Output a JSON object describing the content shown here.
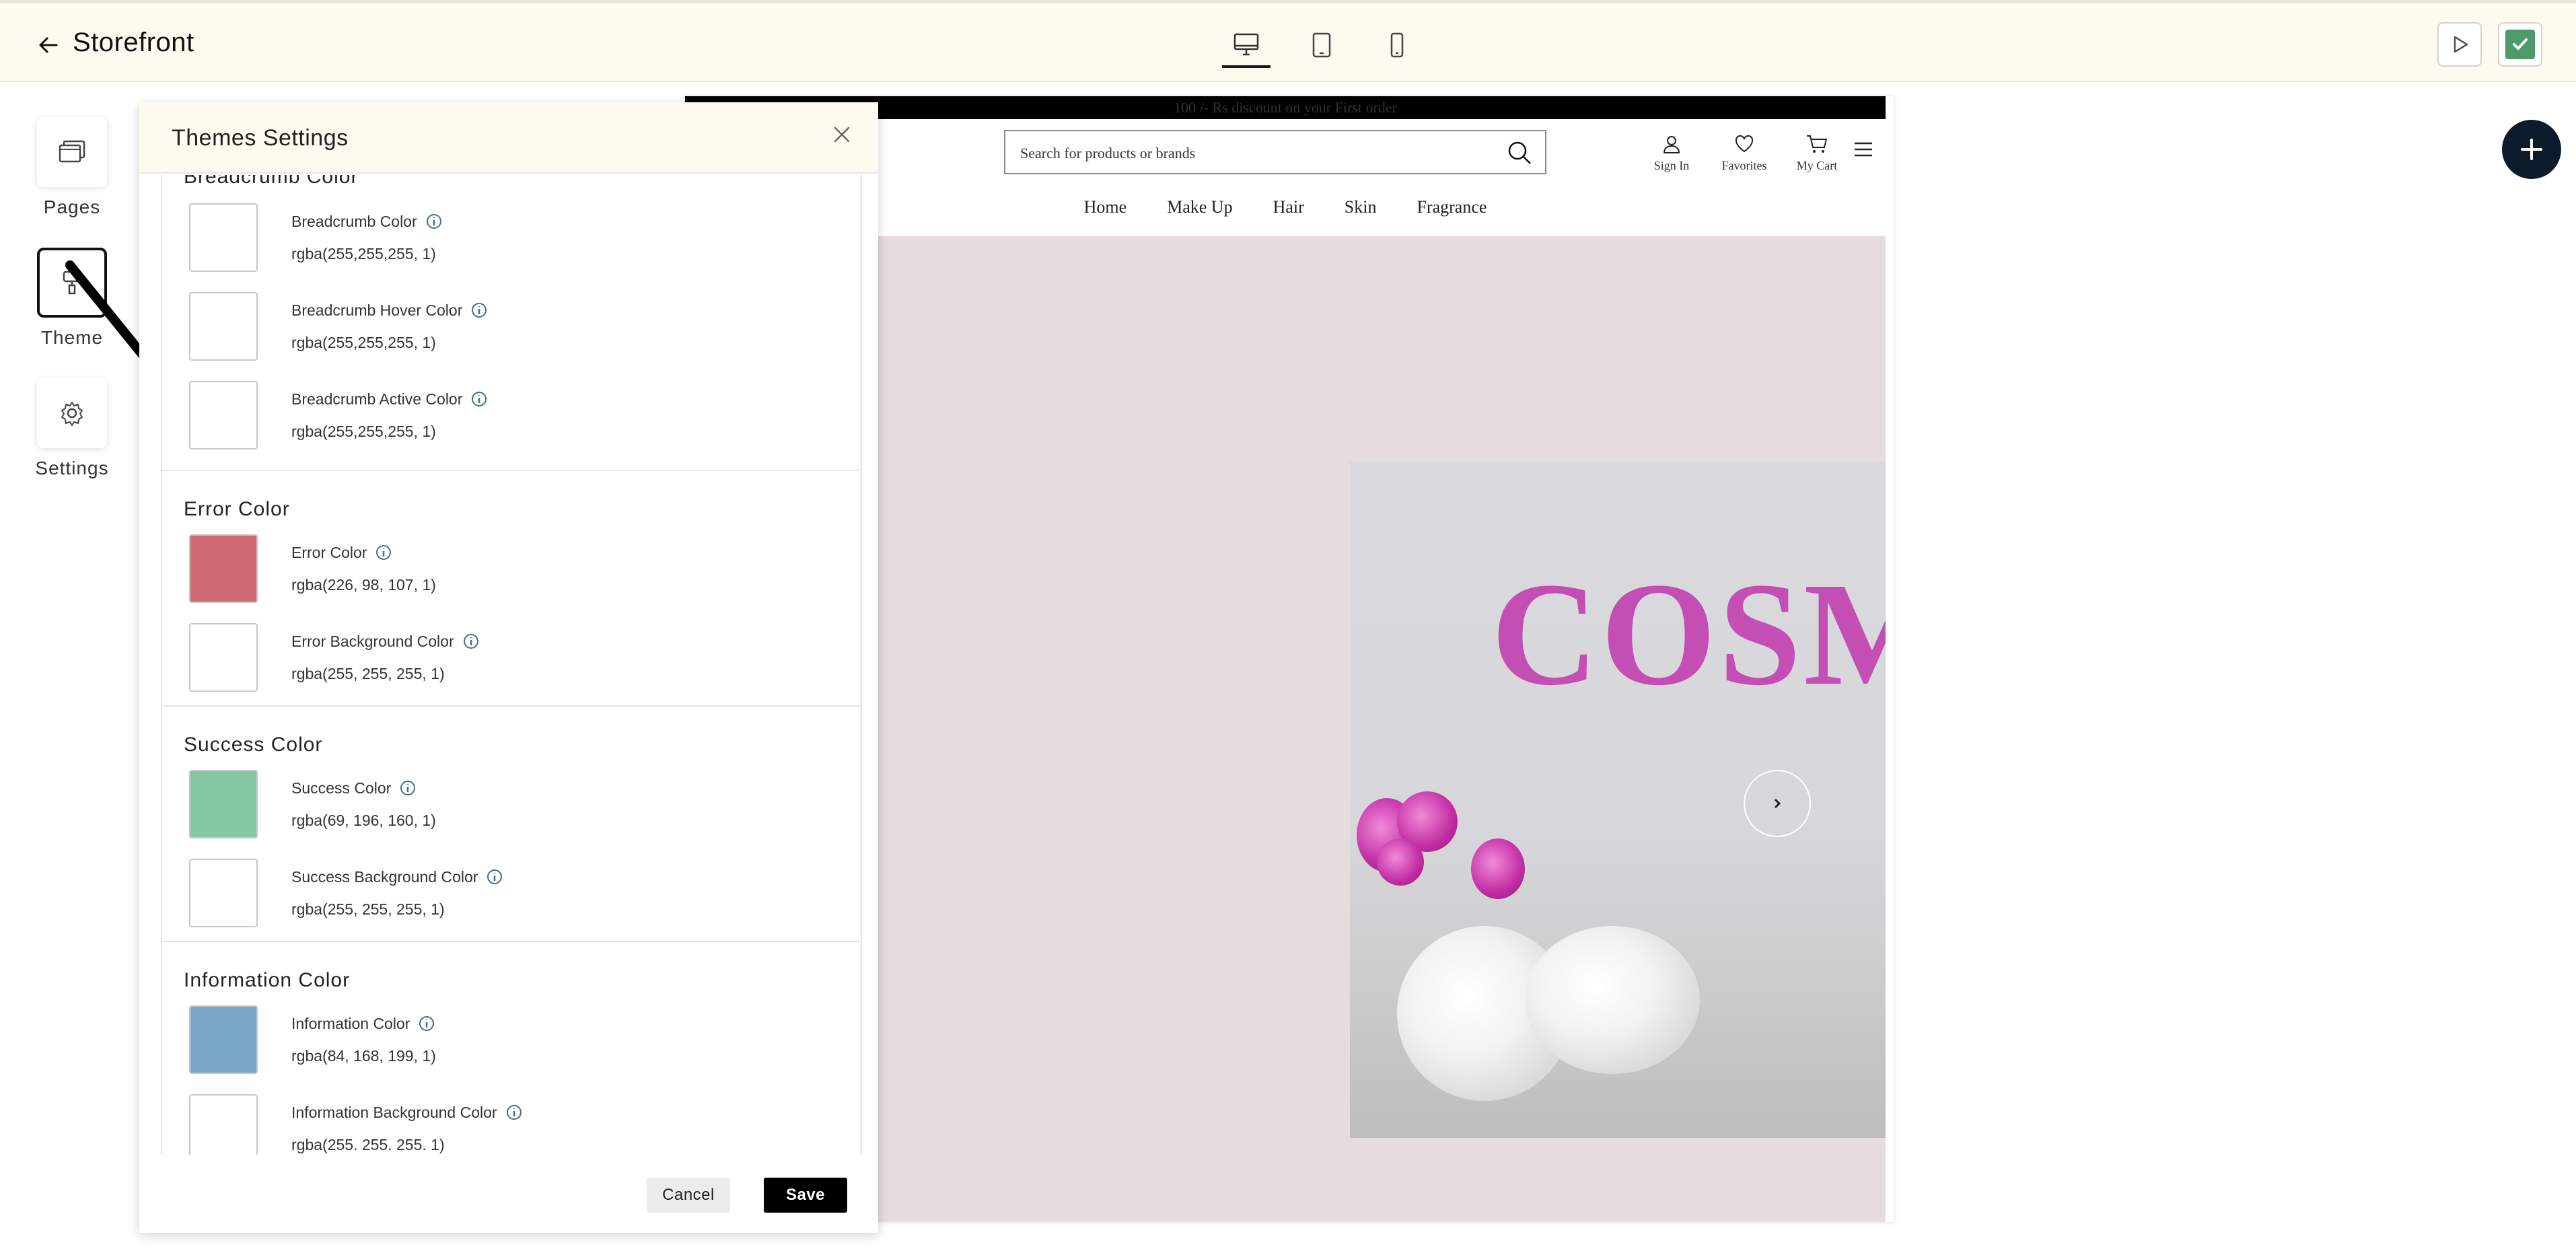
{
  "header": {
    "title": "Storefront",
    "devices": [
      "desktop",
      "tablet",
      "mobile"
    ],
    "active_device": "desktop",
    "publish_color": "#4f9a6b"
  },
  "rail": {
    "items": [
      {
        "label": "Pages",
        "icon": "pages-icon"
      },
      {
        "label": "Theme",
        "icon": "paint-brush-icon",
        "active": true
      },
      {
        "label": "Settings",
        "icon": "gear-icon"
      }
    ]
  },
  "panel": {
    "title": "Themes Settings",
    "sections": [
      {
        "title": "Breadcrumb Color",
        "rows": [
          {
            "label": "Breadcrumb Color",
            "value": "rgba(255,255,255, 1)",
            "swatch": "#ffffff"
          },
          {
            "label": "Breadcrumb Hover Color",
            "value": "rgba(255,255,255, 1)",
            "swatch": "#ffffff"
          },
          {
            "label": "Breadcrumb Active Color",
            "value": "rgba(255,255,255, 1)",
            "swatch": "#ffffff"
          }
        ]
      },
      {
        "title": "Error Color",
        "rows": [
          {
            "label": "Error Color",
            "value": "rgba(226, 98, 107, 1)",
            "swatch": "#cf6a72"
          },
          {
            "label": "Error Background Color",
            "value": "rgba(255, 255, 255, 1)",
            "swatch": "#ffffff"
          }
        ]
      },
      {
        "title": "Success Color",
        "rows": [
          {
            "label": "Success Color",
            "value": "rgba(69, 196, 160, 1)",
            "swatch": "#84c7a3"
          },
          {
            "label": "Success Background Color",
            "value": "rgba(255, 255, 255, 1)",
            "swatch": "#ffffff"
          }
        ]
      },
      {
        "title": "Information Color",
        "rows": [
          {
            "label": "Information Color",
            "value": "rgba(84, 168, 199, 1)",
            "swatch": "#79a8c8"
          },
          {
            "label": "Information Background Color",
            "value": "rgba(255. 255. 255. 1)",
            "swatch": "#ffffff"
          }
        ]
      }
    ],
    "cancel_label": "Cancel",
    "save_label": "Save"
  },
  "preview": {
    "promo": "100 /- Rs discount on your First order",
    "search_placeholder": "Search for products or brands",
    "actions": {
      "sign_in": "Sign In",
      "favorites": "Favorites",
      "cart": "My Cart"
    },
    "nav": [
      "Home",
      "Make Up",
      "Hair",
      "Skin",
      "Fragrance"
    ],
    "hero_word": "COSM"
  }
}
